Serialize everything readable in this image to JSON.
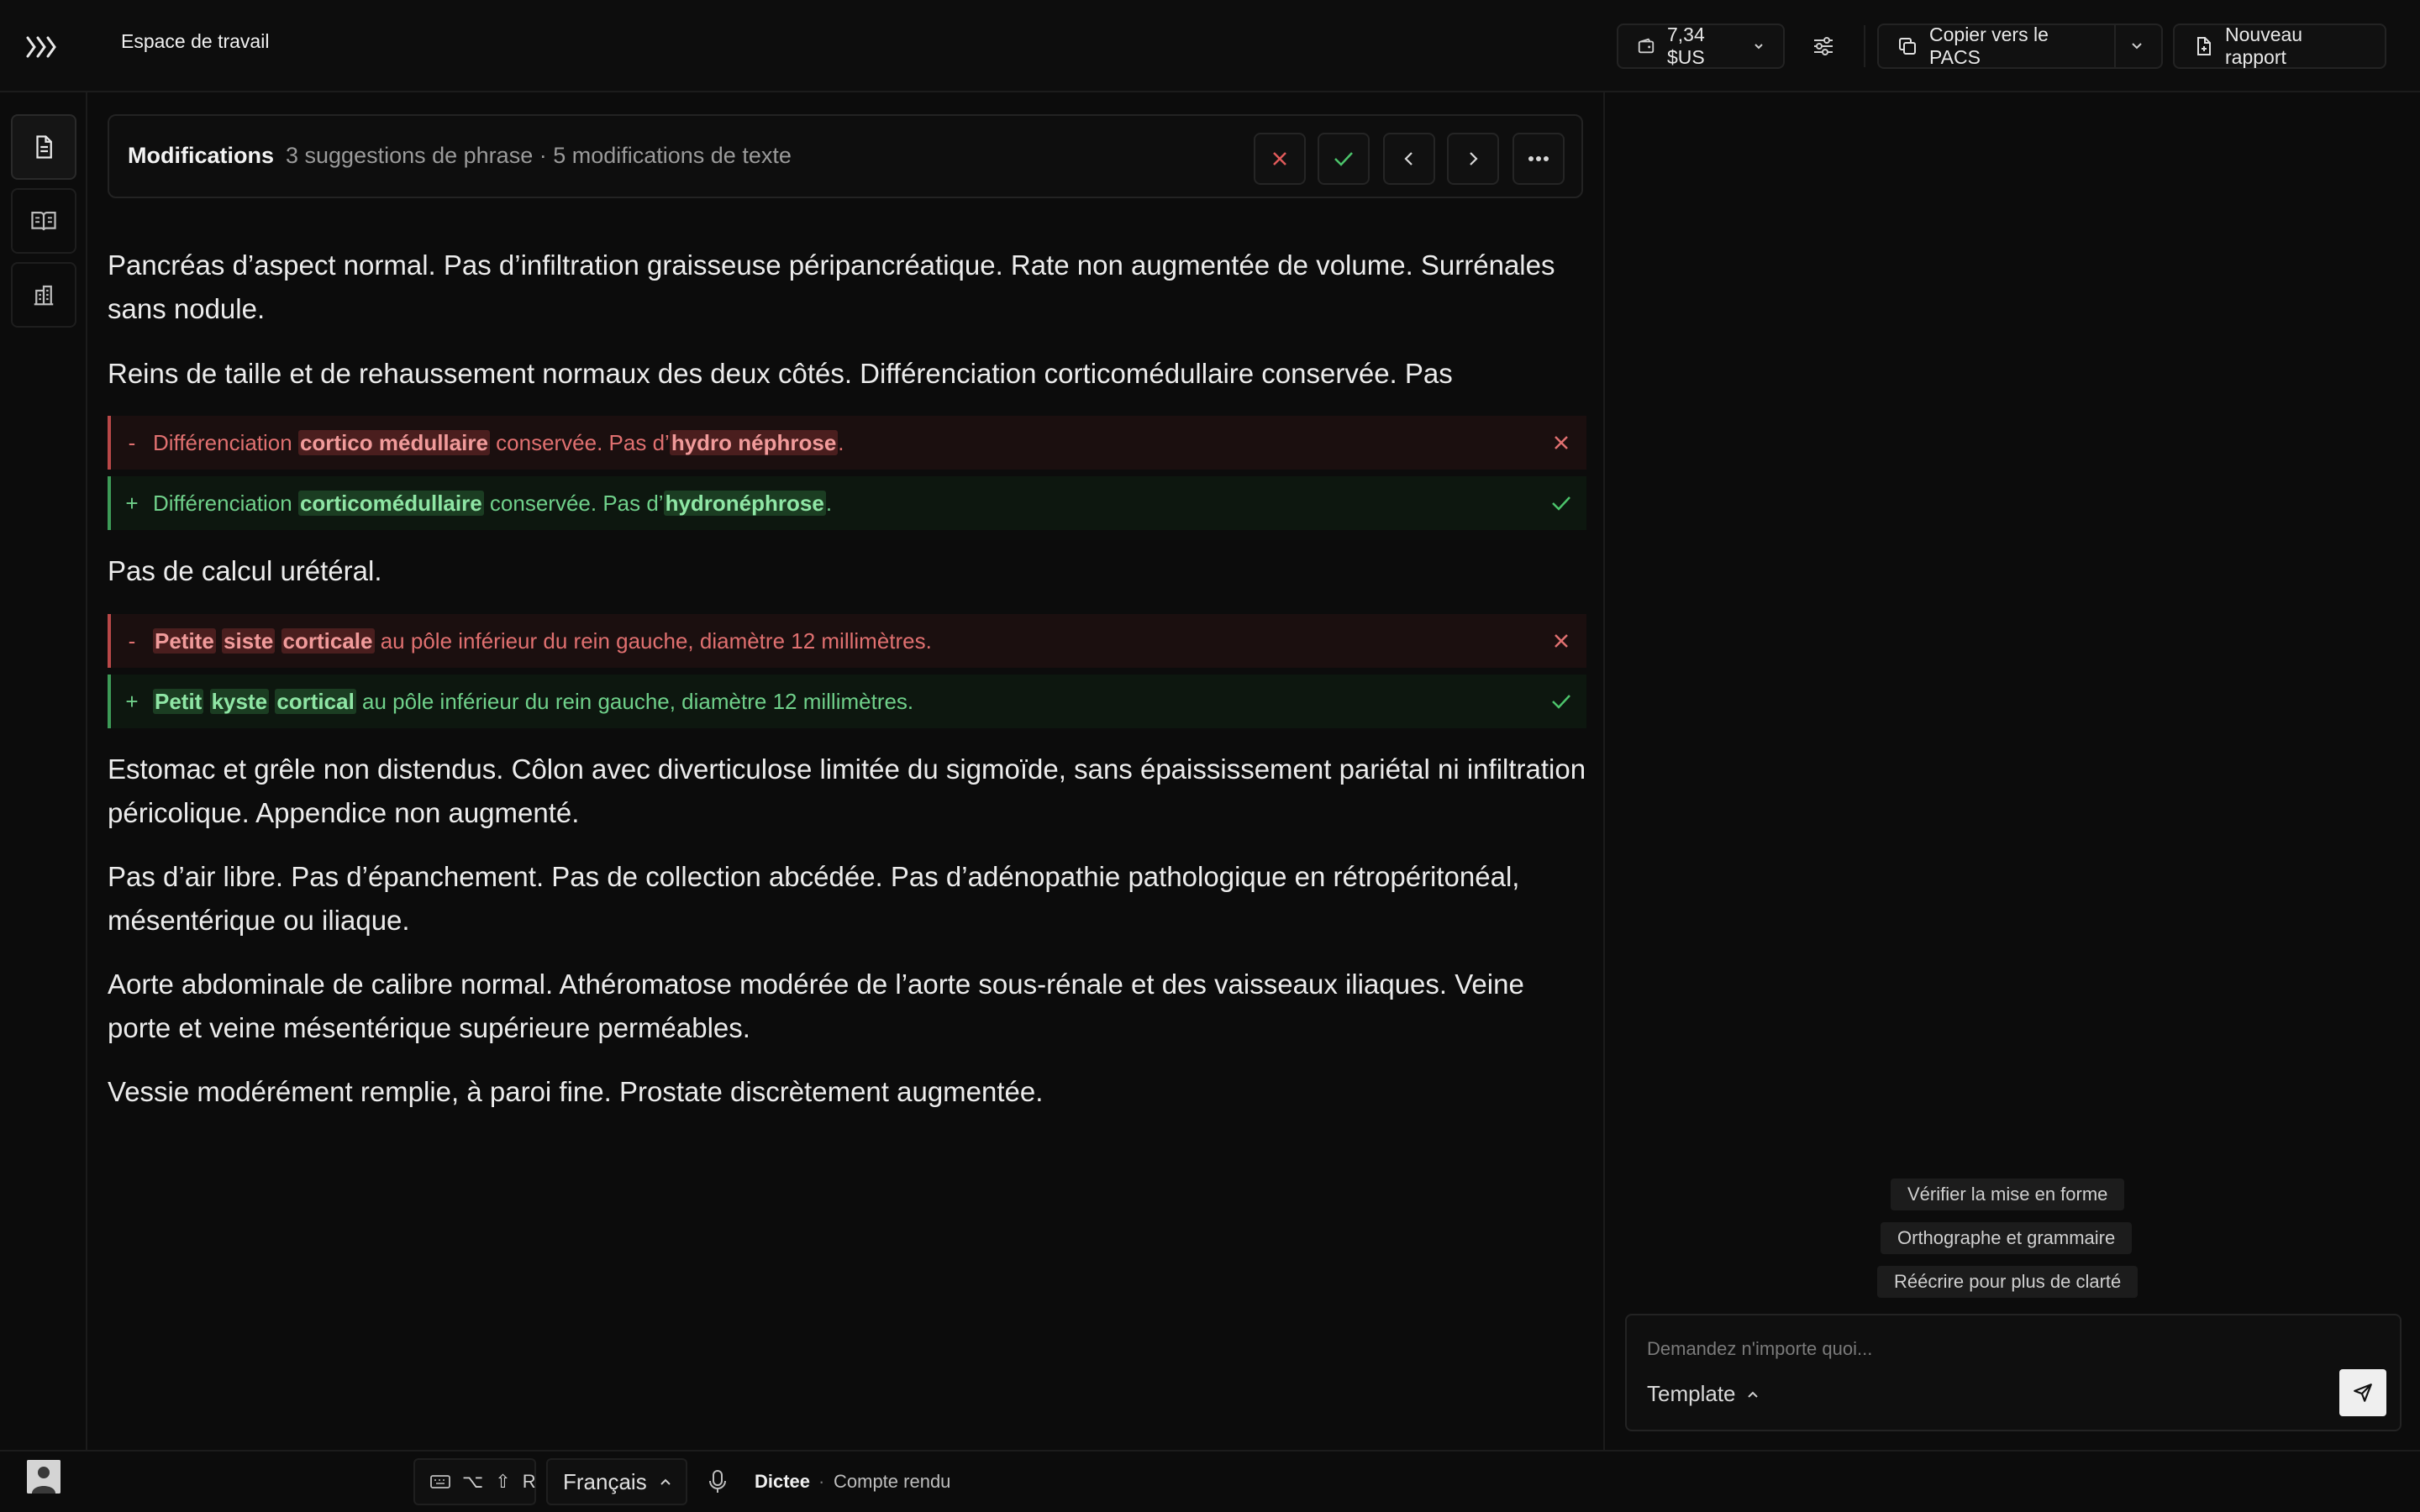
{
  "header": {
    "workspace_title": "Espace de travail",
    "cost_label": "7,34 $US",
    "copy_pacs_label": "Copier vers le PACS",
    "new_report_label": "Nouveau rapport"
  },
  "rail": {
    "items": [
      "document-icon",
      "book-icon",
      "building-icon"
    ]
  },
  "modifications": {
    "title": "Modifications",
    "summary": "3 suggestions de phrase · 5 modifications de texte"
  },
  "report": {
    "para1": "Pancréas d’aspect normal. Pas d’infiltration graisseuse péripancréatique. Rate non augmentée de volume. Surrénales sans nodule.",
    "para2": "Reins de taille et de rehaussement normaux des deux côtés. Différenciation corticomédullaire conservée. Pas",
    "diff1": {
      "del": {
        "sign": "-",
        "seg1": "Différenciation ",
        "hl1": "cortico médullaire",
        "seg2": " conservée. Pas d’",
        "hl2": "hydro néphrose",
        "seg3": "."
      },
      "add": {
        "sign": "+",
        "seg1": "Différenciation ",
        "hl1": "corticomédullaire",
        "seg2": " conservée. Pas d’",
        "hl2": "hydronéphrose",
        "seg3": "."
      }
    },
    "para3": "Pas de calcul urétéral.",
    "diff2": {
      "del": {
        "sign": "-",
        "hl1": "Petite",
        "hl2": "siste",
        "hl3": "corticale",
        "rest": " au pôle inférieur du rein gauche, diamètre 12 millimètres."
      },
      "add": {
        "sign": "+",
        "hl1": "Petit",
        "hl2": "kyste",
        "hl3": "cortical",
        "rest": " au pôle inférieur du rein gauche, diamètre 12 millimètres."
      }
    },
    "para4": "Estomac et grêle non distendus. Côlon avec diverticulose limitée du sigmoïde, sans épaississement pariétal ni infiltration péricolique. Appendice non augmenté.",
    "para5": "Pas d’air libre. Pas d’épanchement. Pas de collection abcédée. Pas d’adénopathie pathologique en rétropéritonéal, mésentérique ou iliaque.",
    "para6": "Aorte abdominale de calibre normal. Athéromatose modérée de l’aorte sous-rénale et des vaisseaux iliaques. Veine porte et veine mésentérique supérieure perméables.",
    "para7": "Vessie modérément remplie, à paroi fine. Prostate discrètement augmentée."
  },
  "assistant": {
    "suggestions": [
      "Vérifier la mise en forme",
      "Orthographe et grammaire",
      "Réécrire pour plus de clarté"
    ],
    "input_placeholder": "Demandez n'importe quoi...",
    "template_label": "Template"
  },
  "footer": {
    "shortcut_keys": [
      "⌥",
      "⇧",
      "R"
    ],
    "language": "Français",
    "dictation_label": "Dictee",
    "separator": "·",
    "dictation_mode": "Compte rendu"
  },
  "colors": {
    "background": "#0c0c0c",
    "deletion": "#e07070",
    "addition": "#6fd08a",
    "reject_icon": "#e05a5a",
    "accept_icon": "#4cc46b"
  }
}
